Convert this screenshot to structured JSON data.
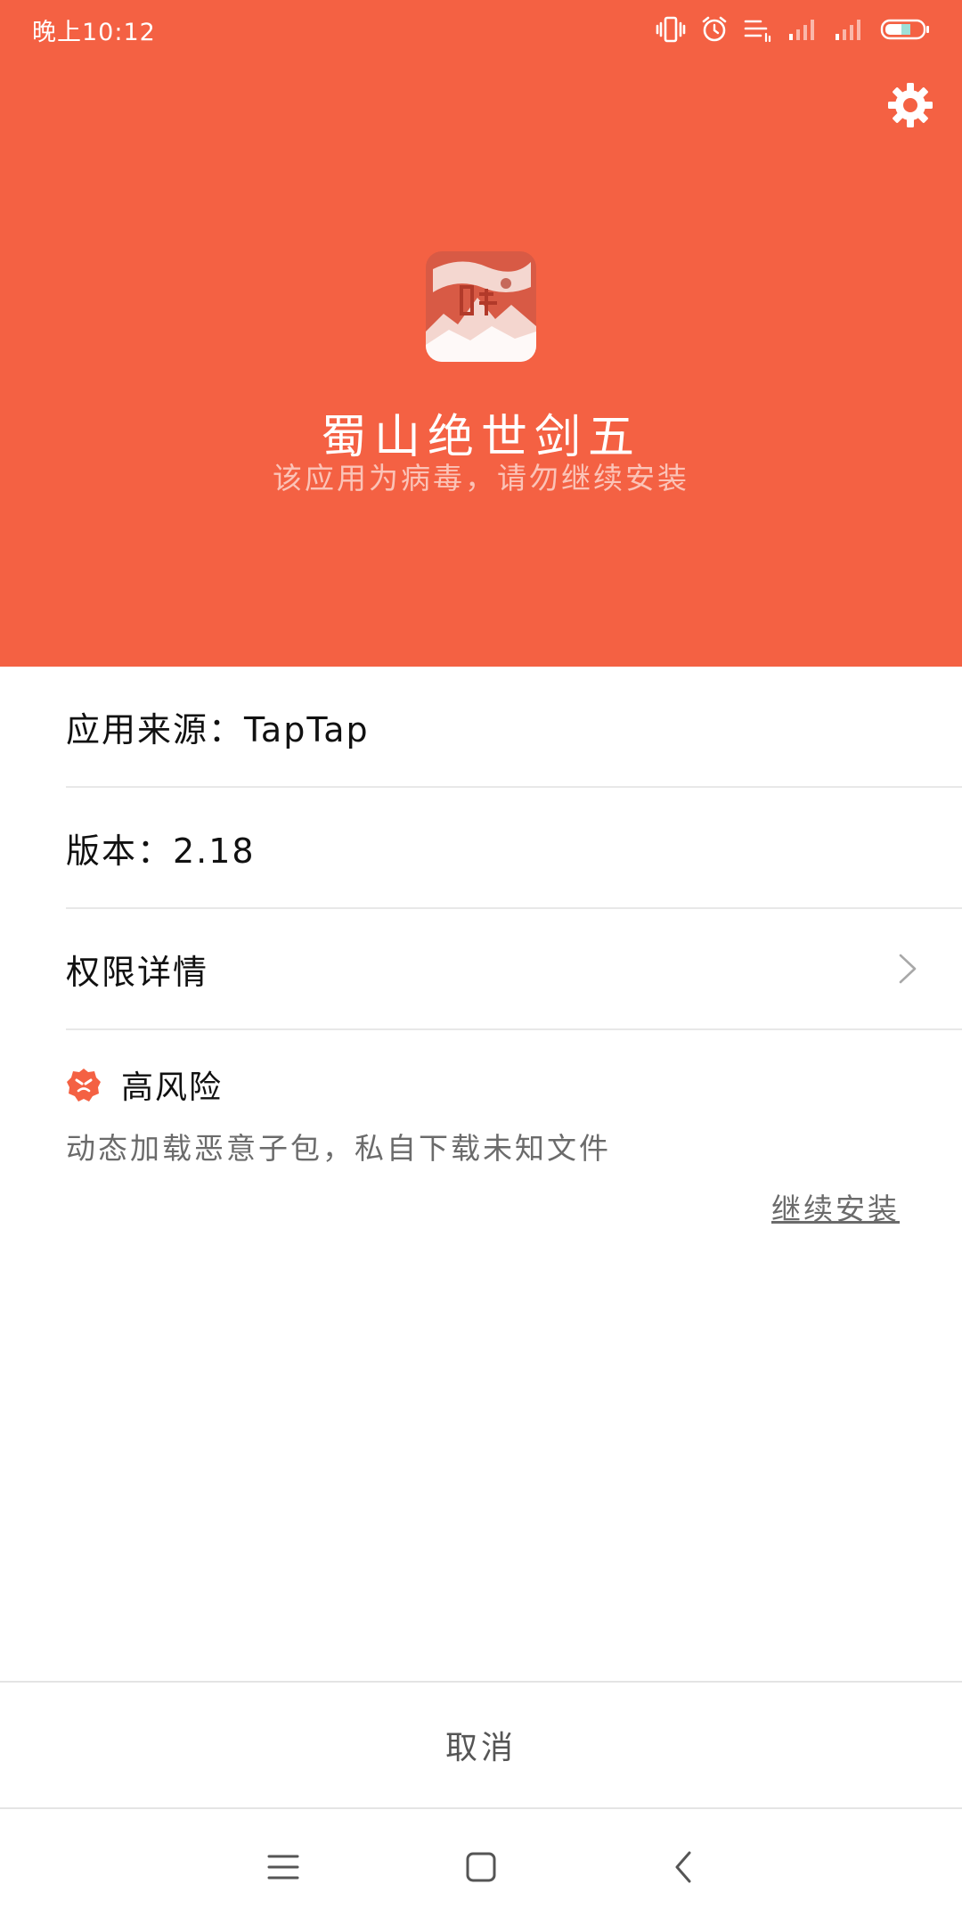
{
  "status_bar": {
    "time": "晚上10:12",
    "icons": [
      "vibrate-icon",
      "alarm-icon",
      "notification-icon",
      "signal-icon",
      "signal-icon",
      "battery-icon"
    ]
  },
  "header": {
    "background_color": "#f46143",
    "settings_icon": "gear-icon",
    "app_name": "蜀山绝世剑五",
    "warning": "该应用为病毒，请勿继续安装"
  },
  "info": {
    "source": "应用来源：TapTap",
    "version": "版本：2.18",
    "permissions": "权限详情"
  },
  "risk": {
    "label": "高风险",
    "description": "动态加载恶意子包，私自下载未知文件",
    "continue_label": "继续安装",
    "accent_color": "#f46143"
  },
  "footer": {
    "cancel_label": "取消"
  },
  "nav": {
    "icons": [
      "menu-icon",
      "home-icon",
      "back-icon"
    ]
  }
}
